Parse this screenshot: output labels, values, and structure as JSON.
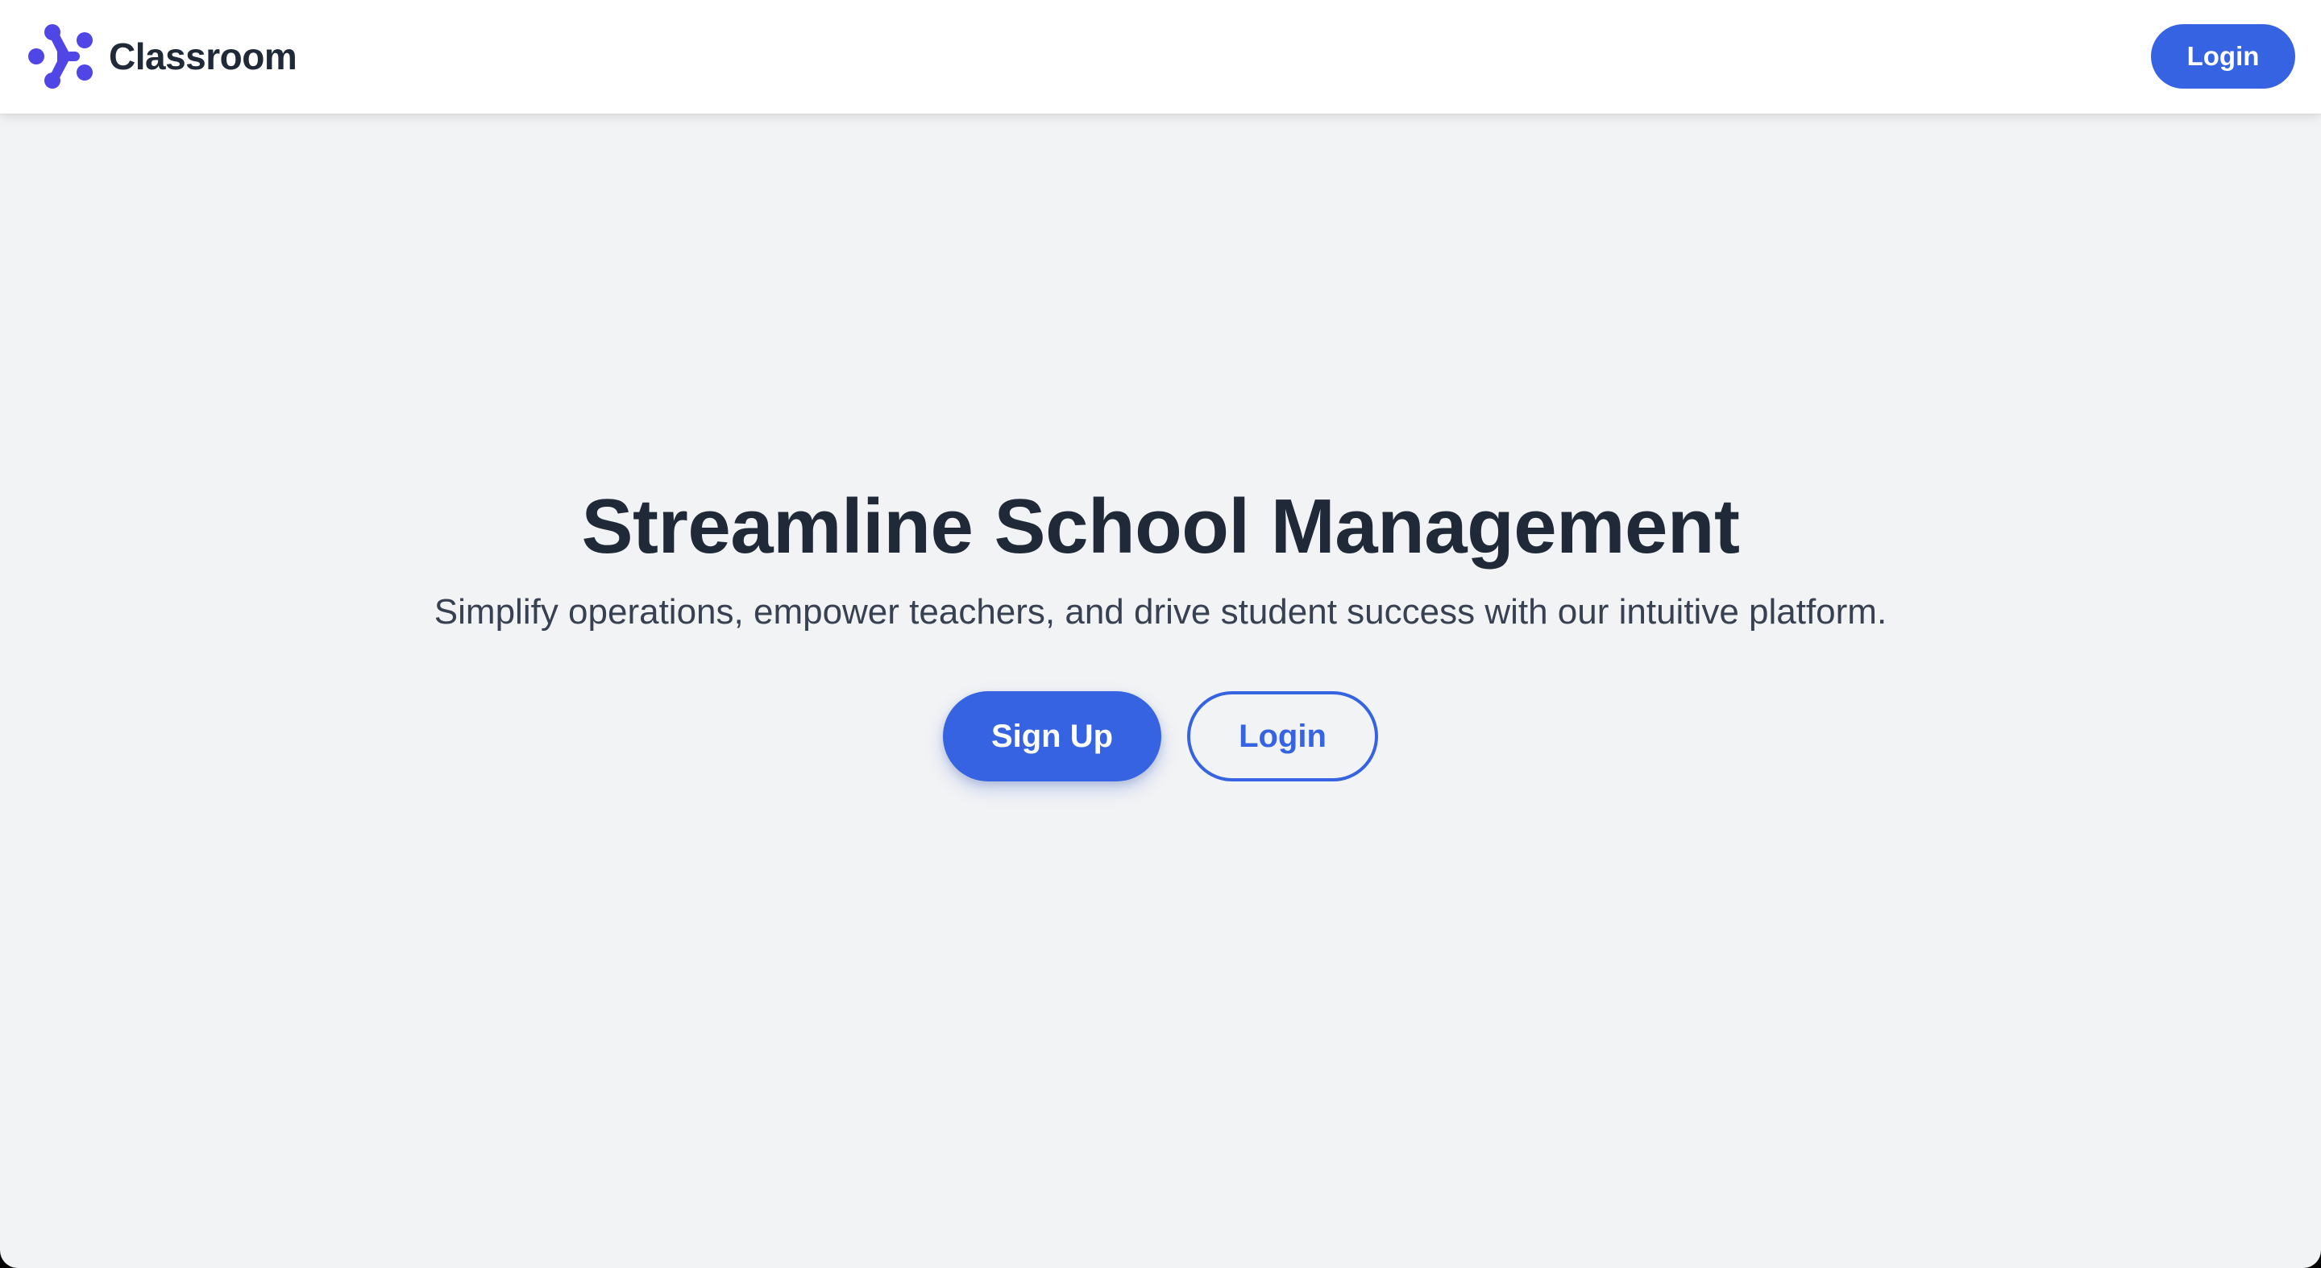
{
  "app": {
    "brand_name": "Classroom",
    "logo_icon": "dots-network-logo-icon"
  },
  "navbar": {
    "login_label": "Login"
  },
  "hero": {
    "title": "Streamline School Management",
    "subtitle": "Simplify operations, empower teachers, and drive student success with our intuitive platform.",
    "signup_label": "Sign Up",
    "login_label": "Login"
  },
  "colors": {
    "primary": "#3563e2",
    "logo": "#4f46e5",
    "text_dark": "#1f2937",
    "text_body": "#374151",
    "background": "#f2f3f5",
    "navbar_bg": "#ffffff"
  }
}
